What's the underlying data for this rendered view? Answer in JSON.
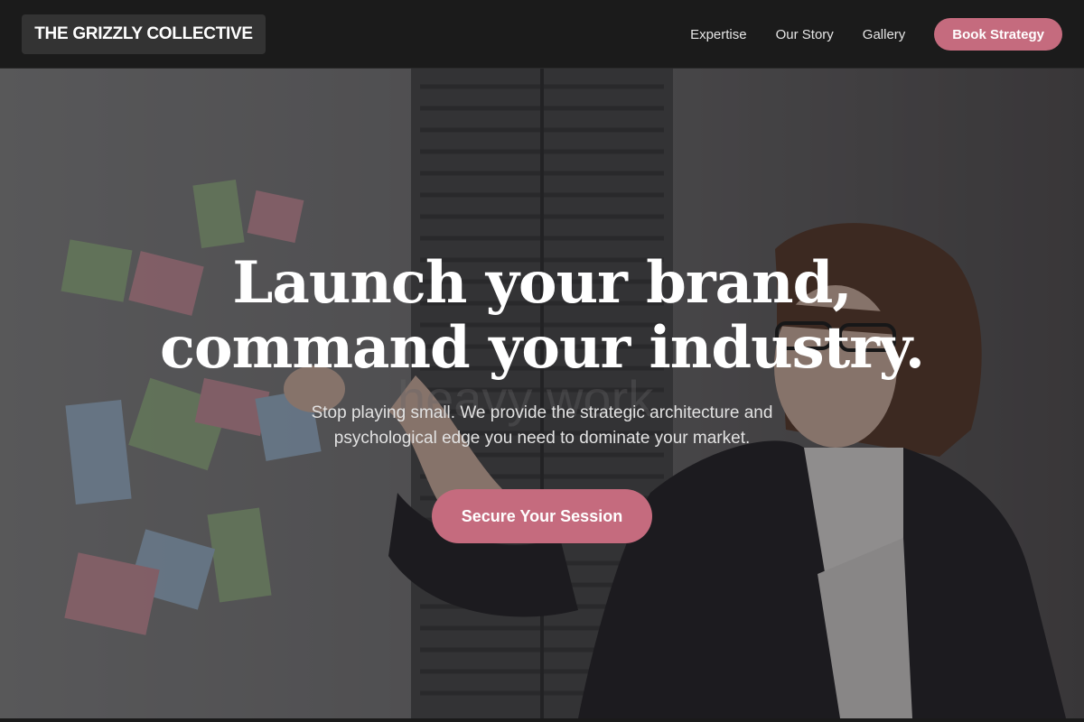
{
  "nav": {
    "logo": "THE GRIZZLY COLLECTIVE",
    "links": [
      "Expertise",
      "Our Story",
      "Gallery"
    ],
    "cta_label": "Book Strategy"
  },
  "hero": {
    "headline_line1": "Launch your brand,",
    "headline_line2": "command your industry.",
    "subtext": "Stop playing small. We provide the strategic architecture and psychological edge you need to dominate your market.",
    "cta_label": "Secure Your Session",
    "background_watermark": "heavy work"
  },
  "colors": {
    "accent": "#c56b7e",
    "nav_bg": "#1b1b1b",
    "logo_bg": "#333333"
  }
}
